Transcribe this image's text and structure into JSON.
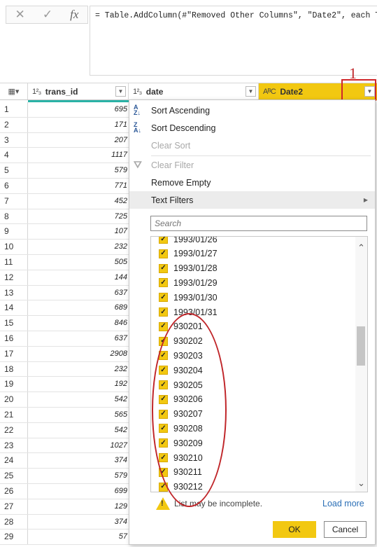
{
  "formula_bar": {
    "cancel_icon": "✕",
    "commit_icon": "✓",
    "fx_label": "fx",
    "formula": "= Table.AddColumn(#\"Removed Other Columns\", \"Date2\", each T"
  },
  "grid": {
    "columns": [
      {
        "type_icon": "1²₃",
        "name": "trans_id"
      },
      {
        "type_icon": "1²₃",
        "name": "date"
      },
      {
        "type_icon": "AᴮC",
        "name": "Date2"
      }
    ],
    "rows": [
      {
        "n": "1",
        "v": "695"
      },
      {
        "n": "2",
        "v": "171"
      },
      {
        "n": "3",
        "v": "207"
      },
      {
        "n": "4",
        "v": "1117"
      },
      {
        "n": "5",
        "v": "579"
      },
      {
        "n": "6",
        "v": "771"
      },
      {
        "n": "7",
        "v": "452"
      },
      {
        "n": "8",
        "v": "725"
      },
      {
        "n": "9",
        "v": "107"
      },
      {
        "n": "10",
        "v": "232"
      },
      {
        "n": "11",
        "v": "505"
      },
      {
        "n": "12",
        "v": "144"
      },
      {
        "n": "13",
        "v": "637"
      },
      {
        "n": "14",
        "v": "689"
      },
      {
        "n": "15",
        "v": "846"
      },
      {
        "n": "16",
        "v": "637"
      },
      {
        "n": "17",
        "v": "2908"
      },
      {
        "n": "18",
        "v": "232"
      },
      {
        "n": "19",
        "v": "192"
      },
      {
        "n": "20",
        "v": "542"
      },
      {
        "n": "21",
        "v": "565"
      },
      {
        "n": "22",
        "v": "542"
      },
      {
        "n": "23",
        "v": "1027"
      },
      {
        "n": "24",
        "v": "374"
      },
      {
        "n": "25",
        "v": "579"
      },
      {
        "n": "26",
        "v": "699"
      },
      {
        "n": "27",
        "v": "129"
      },
      {
        "n": "28",
        "v": "374"
      },
      {
        "n": "29",
        "v": "57"
      }
    ]
  },
  "annotation": {
    "label": "1"
  },
  "menu": {
    "sort_ascending": "Sort Ascending",
    "sort_descending": "Sort Descending",
    "clear_sort": "Clear Sort",
    "clear_filter": "Clear Filter",
    "remove_empty": "Remove Empty",
    "text_filters": "Text Filters",
    "search_placeholder": "Search",
    "values": [
      "1993/01/26",
      "1993/01/27",
      "1993/01/28",
      "1993/01/29",
      "1993/01/30",
      "1993/01/31",
      "930201",
      "930202",
      "930203",
      "930204",
      "930205",
      "930206",
      "930207",
      "930208",
      "930209",
      "930210",
      "930211",
      "930212"
    ],
    "warning_text": "List may be incomplete.",
    "load_more": "Load more",
    "ok": "OK",
    "cancel": "Cancel"
  }
}
